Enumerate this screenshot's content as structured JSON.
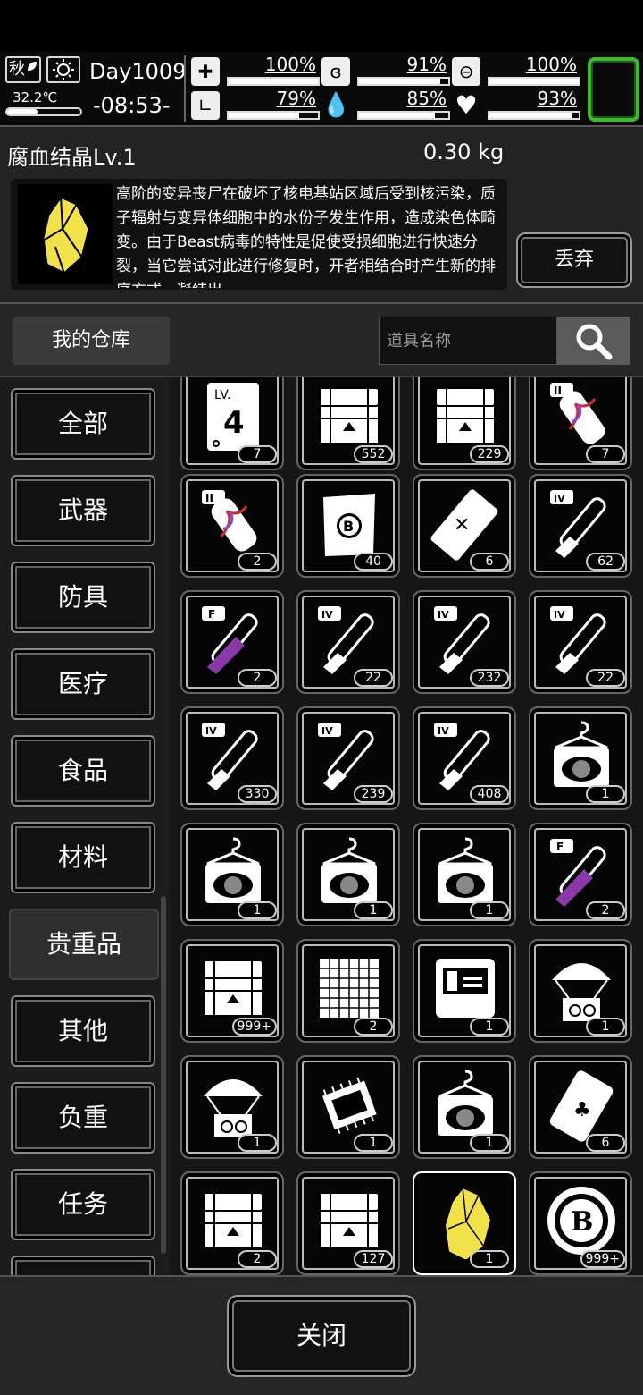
{
  "status": {
    "season": "秋",
    "temperature": "32.2℃",
    "temperature_level": 0.42,
    "day": "Day1009",
    "time": "-08:53-",
    "stats": [
      {
        "icon": "medkit-icon",
        "value": "100%",
        "level": 1.0
      },
      {
        "icon": "stomach-icon",
        "value": "91%",
        "level": 0.91
      },
      {
        "icon": "pill-icon",
        "value": "100%",
        "level": 1.0
      },
      {
        "icon": "boot-icon",
        "value": "79%",
        "level": 0.79
      },
      {
        "icon": "water-drop-icon",
        "value": "85%",
        "level": 0.85
      },
      {
        "icon": "heart-icon",
        "value": "93%",
        "level": 0.93
      }
    ]
  },
  "detail": {
    "name": "腐血结晶Lv.1",
    "weight": "0.30 kg",
    "description": "高阶的变异丧尸在破坏了核电基站区域后受到核污染，质子辐射与变异体细胞中的水份子发生作用，造成染色体畸变。由于Beast病毒的特性是促使受损细胞进行快速分裂，当它尝试对此进行修复时，开者相结合时产生新的排序方式，凝结出",
    "discard_label": "丢弃"
  },
  "toolbar": {
    "warehouse_label": "我的仓库",
    "search_placeholder": "道具名称"
  },
  "categories": [
    "全部",
    "武器",
    "防具",
    "医疗",
    "食品",
    "材料",
    "贵重品",
    "其他",
    "负重",
    "任务"
  ],
  "active_category": "贵重品",
  "items": [
    {
      "kind": "card-lv4",
      "count": "7"
    },
    {
      "kind": "chest",
      "count": "552"
    },
    {
      "kind": "chest",
      "count": "229"
    },
    {
      "kind": "dna-tube",
      "count": "7"
    },
    {
      "kind": "dna-tube",
      "count": "2"
    },
    {
      "kind": "coin-note",
      "count": "40"
    },
    {
      "kind": "ticket",
      "count": "6"
    },
    {
      "kind": "test-tube",
      "count": "62"
    },
    {
      "kind": "test-tube-purple",
      "count": "2"
    },
    {
      "kind": "test-tube",
      "count": "22"
    },
    {
      "kind": "test-tube",
      "count": "232"
    },
    {
      "kind": "test-tube",
      "count": "22"
    },
    {
      "kind": "test-tube",
      "count": "330"
    },
    {
      "kind": "test-tube",
      "count": "239"
    },
    {
      "kind": "test-tube",
      "count": "408"
    },
    {
      "kind": "costume",
      "count": "1"
    },
    {
      "kind": "costume",
      "count": "1"
    },
    {
      "kind": "costume",
      "count": "1"
    },
    {
      "kind": "costume",
      "count": "1"
    },
    {
      "kind": "test-tube-purple",
      "count": "2"
    },
    {
      "kind": "chest",
      "count": "999+"
    },
    {
      "kind": "blueprint-grid",
      "count": "2"
    },
    {
      "kind": "blueprint-machine",
      "count": "1"
    },
    {
      "kind": "airdrop",
      "count": "1"
    },
    {
      "kind": "airdrop",
      "count": "1"
    },
    {
      "kind": "chip",
      "count": "1"
    },
    {
      "kind": "costume",
      "count": "1"
    },
    {
      "kind": "seed-bag",
      "count": "6"
    },
    {
      "kind": "chest",
      "count": "2"
    },
    {
      "kind": "chest",
      "count": "127"
    },
    {
      "kind": "crystal",
      "count": "1",
      "selected": true
    },
    {
      "kind": "coin",
      "count": "999+"
    }
  ],
  "footer": {
    "close_label": "关闭"
  },
  "colors": {
    "accent_green": "#3cba2e",
    "crystal_yellow": "#f2e24a",
    "purple_liquid": "#8a3aa8"
  }
}
